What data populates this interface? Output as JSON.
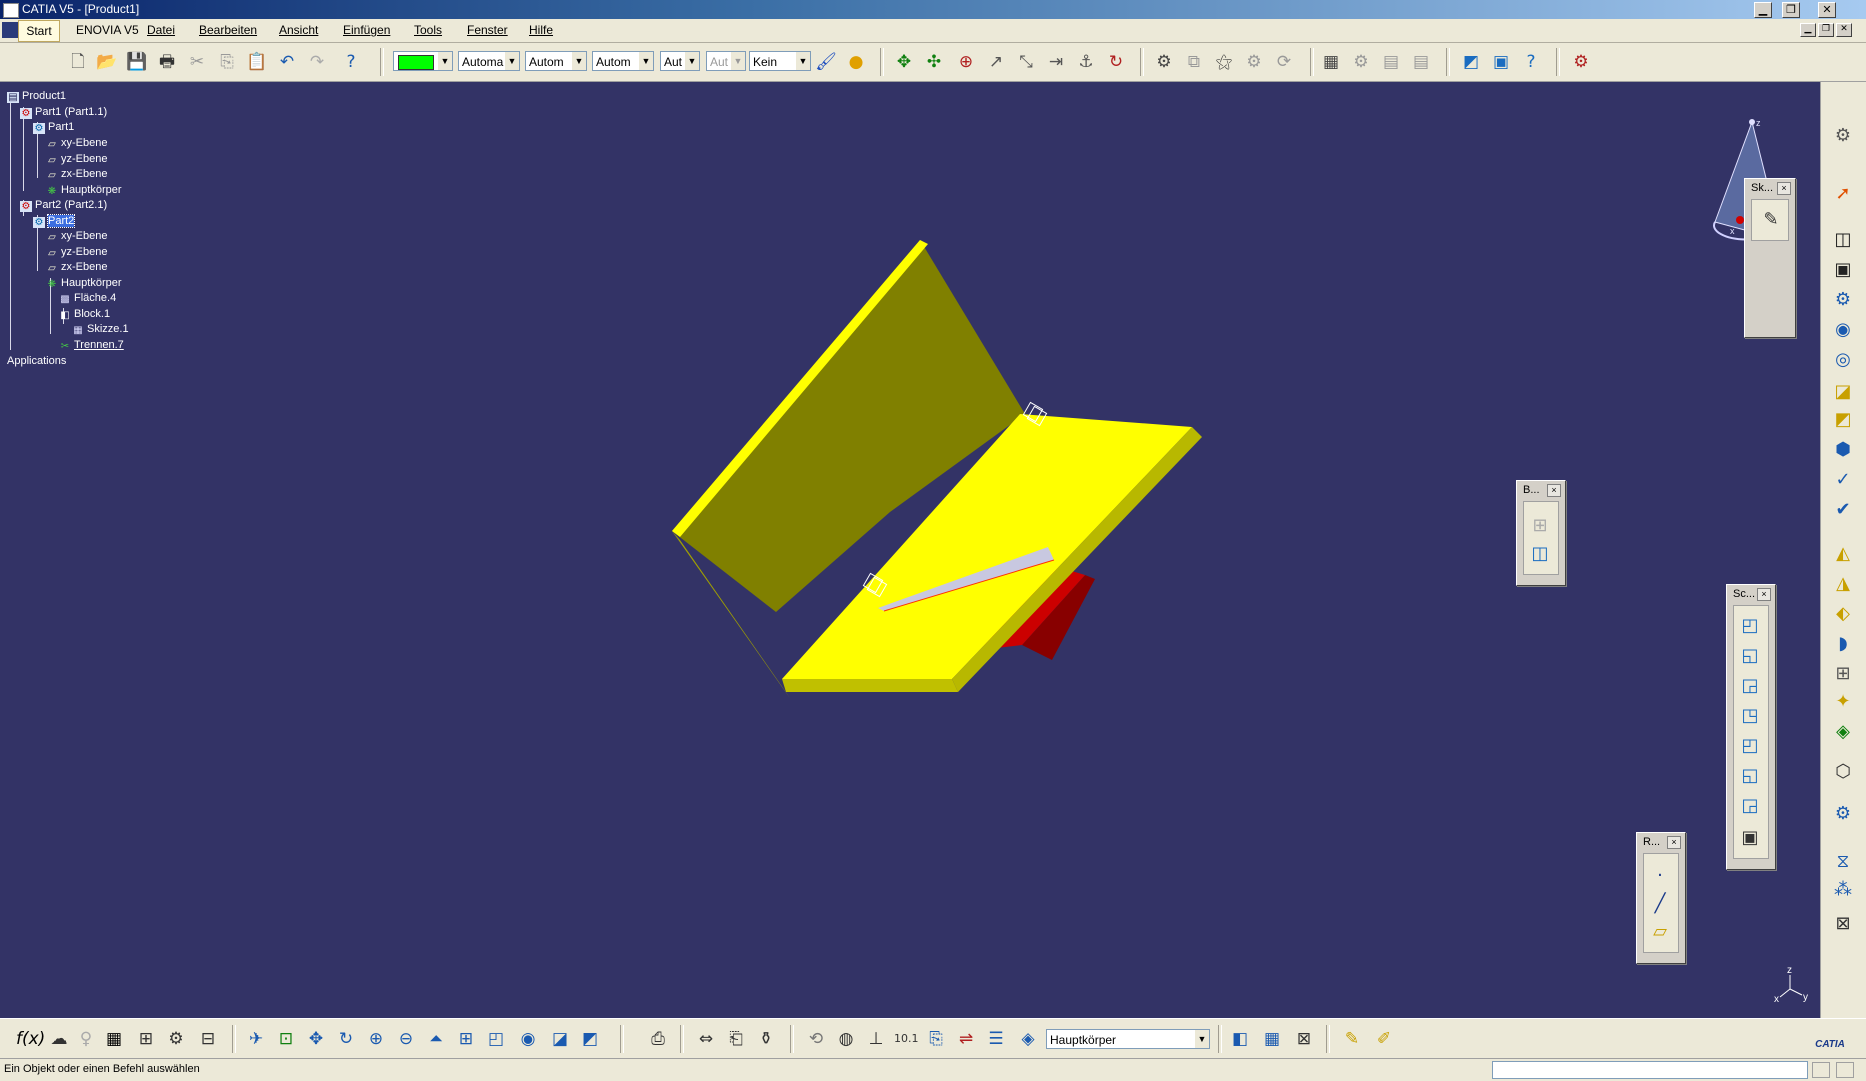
{
  "window": {
    "title": "CATIA V5 - [Product1]",
    "controls": {
      "minimize": "▁",
      "restore": "❐",
      "close": "✕"
    }
  },
  "menu": {
    "start": "Start",
    "items": [
      "ENOVIA V5",
      "Datei",
      "Bearbeiten",
      "Ansicht",
      "Einfügen",
      "Tools",
      "Fenster",
      "Hilfe"
    ]
  },
  "toolbar": {
    "color_value": "#00ff00",
    "combos": [
      "Automa",
      "Autom",
      "Autom",
      "Aut",
      "Aut",
      "Kein"
    ]
  },
  "tree": {
    "nodes": [
      {
        "label": "Product1",
        "icon": "product-icon"
      },
      {
        "label": "Part1 (Part1.1)",
        "icon": "part-instance-icon"
      },
      {
        "label": "Part1",
        "icon": "part-icon"
      },
      {
        "label": "xy-Ebene",
        "icon": "plane-icon"
      },
      {
        "label": "yz-Ebene",
        "icon": "plane-icon"
      },
      {
        "label": "zx-Ebene",
        "icon": "plane-icon"
      },
      {
        "label": "Hauptkörper",
        "icon": "body-icon"
      },
      {
        "label": "Part2 (Part2.1)",
        "icon": "part-instance-icon"
      },
      {
        "label": "Part2",
        "icon": "part-icon"
      },
      {
        "label": "xy-Ebene",
        "icon": "plane-icon"
      },
      {
        "label": "yz-Ebene",
        "icon": "plane-icon"
      },
      {
        "label": "zx-Ebene",
        "icon": "plane-icon"
      },
      {
        "label": "Hauptkörper",
        "icon": "body-icon"
      },
      {
        "label": "Fläche.4",
        "icon": "surface-icon"
      },
      {
        "label": "Block.1",
        "icon": "pad-icon"
      },
      {
        "label": "Skizze.1",
        "icon": "sketch-icon"
      },
      {
        "label": "Trennen.7",
        "icon": "split-icon"
      },
      {
        "label": "Applications",
        "icon": ""
      }
    ]
  },
  "palettes": {
    "sketch": {
      "title": "Sk..."
    },
    "bool": {
      "title": "B..."
    },
    "scene": {
      "title": "Sc..."
    },
    "ref": {
      "title": "R..."
    }
  },
  "compass": {
    "x": "x",
    "y": "y",
    "z": "z"
  },
  "bottom": {
    "body_select": "Hauptkörper"
  },
  "status": {
    "message": "Ein Objekt oder einen Befehl auswählen"
  },
  "colors": {
    "viewport_bg": "#333366",
    "part_yellow": "#ffff00",
    "part_olive": "#808000",
    "part_red": "#cc0000"
  }
}
